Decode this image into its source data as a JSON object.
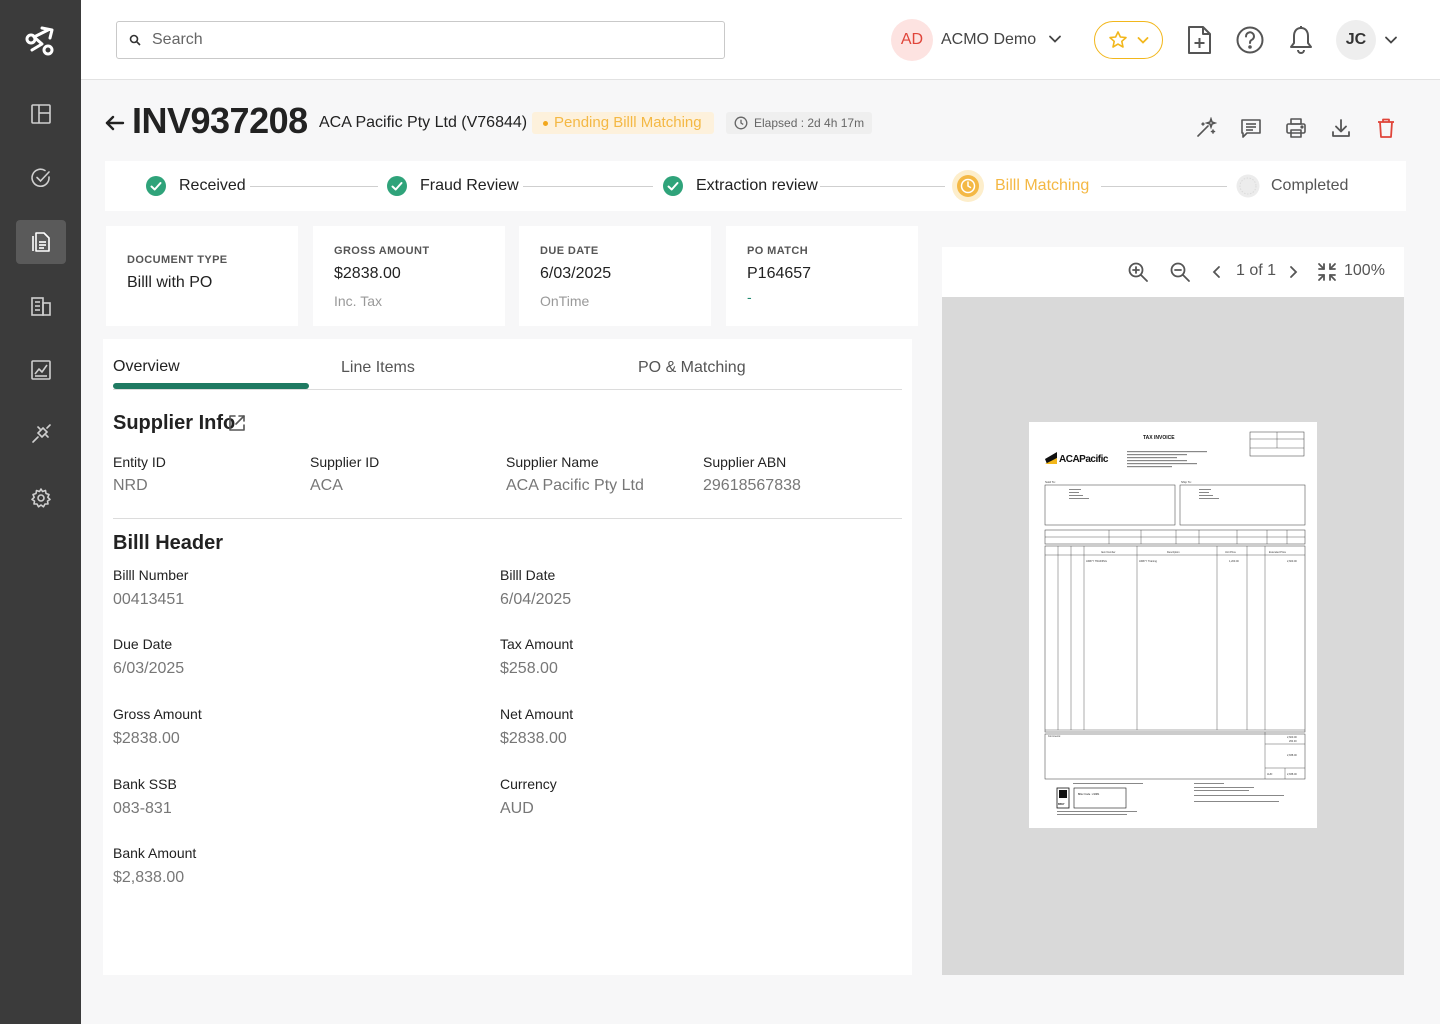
{
  "search": {
    "placeholder": "Search"
  },
  "org": {
    "initials": "AD",
    "name": "ACMO Demo"
  },
  "user": {
    "initials": "JC"
  },
  "colors": {
    "accent": "#1f7a62",
    "pending": "#f4b844",
    "success": "#2fa37a",
    "delete": "#e0453a"
  },
  "sidebar": {
    "items": [
      {
        "name": "dashboard-icon"
      },
      {
        "name": "tasks-icon"
      },
      {
        "name": "documents-icon",
        "active": true
      },
      {
        "name": "organizations-icon"
      },
      {
        "name": "reports-icon"
      },
      {
        "name": "integrations-icon"
      },
      {
        "name": "settings-icon"
      }
    ]
  },
  "invoice": {
    "number": "INV937208",
    "supplier": "ACA Pacific Pty Ltd (V76844)",
    "status": "Pending Billl Matching",
    "elapsed": "Elapsed : 2d 4h 17m"
  },
  "steps": [
    {
      "label": "Received",
      "state": "done"
    },
    {
      "label": "Fraud Review",
      "state": "done"
    },
    {
      "label": "Extraction review",
      "state": "done"
    },
    {
      "label": "Billl Matching",
      "state": "current"
    },
    {
      "label": "Completed",
      "state": "pending"
    }
  ],
  "cards": [
    {
      "label": "Document type",
      "value": "Billl with PO",
      "sub": ""
    },
    {
      "label": "Gross amount",
      "value": "$2838.00",
      "sub": "Inc. Tax"
    },
    {
      "label": "Due date",
      "value": "6/03/2025",
      "sub": "OnTime"
    },
    {
      "label": "PO Match",
      "value": "P164657",
      "sub": "-"
    }
  ],
  "tabs": [
    "Overview",
    "Line Items",
    "PO & Matching"
  ],
  "supplier_info": {
    "title": "Supplier Info",
    "fields": [
      {
        "label": "Entity ID",
        "value": "NRD"
      },
      {
        "label": "Supplier ID",
        "value": "ACA"
      },
      {
        "label": "Supplier Name",
        "value": "ACA Pacific Pty Ltd"
      },
      {
        "label": "Supplier ABN",
        "value": "29618567838"
      }
    ]
  },
  "bill_header": {
    "title": "Billl Header",
    "fields": [
      {
        "label": "Billl Number",
        "value": "00413451"
      },
      {
        "label": "Billl Date",
        "value": "6/04/2025"
      },
      {
        "label": "Due Date",
        "value": "6/03/2025"
      },
      {
        "label": "Tax Amount",
        "value": "$258.00"
      },
      {
        "label": "Gross Amount",
        "value": "$2838.00"
      },
      {
        "label": "Net Amount",
        "value": "$2838.00"
      },
      {
        "label": "Bank SSB",
        "value": "083-831"
      },
      {
        "label": "Currency",
        "value": "AUD"
      },
      {
        "label": "Bank Amount",
        "value": "$2,838.00"
      }
    ]
  },
  "viewer": {
    "page_info": "1 of 1",
    "zoom": "100%"
  },
  "doc_preview": {
    "title": "TAX INVOICE",
    "logo": "ACAPacific",
    "sold_to": "Sold To:",
    "ship_to": "Ship To:",
    "col_item": "Item Number",
    "col_desc": "Description",
    "col_unit": "Unit Price",
    "col_ext": "Extended Price",
    "row_item": "ASBYY TRAINING",
    "row_desc": "ASBYY Training",
    "row_unit": "1,200.00",
    "row_ext": "2,600.00",
    "comments": "Comments:",
    "subtotal": "2,600.00",
    "gst": "260.00",
    "total": "2,838.00",
    "currency": "AUD",
    "biller": "Biller Code : 21981",
    "bpay": "BPAY"
  }
}
